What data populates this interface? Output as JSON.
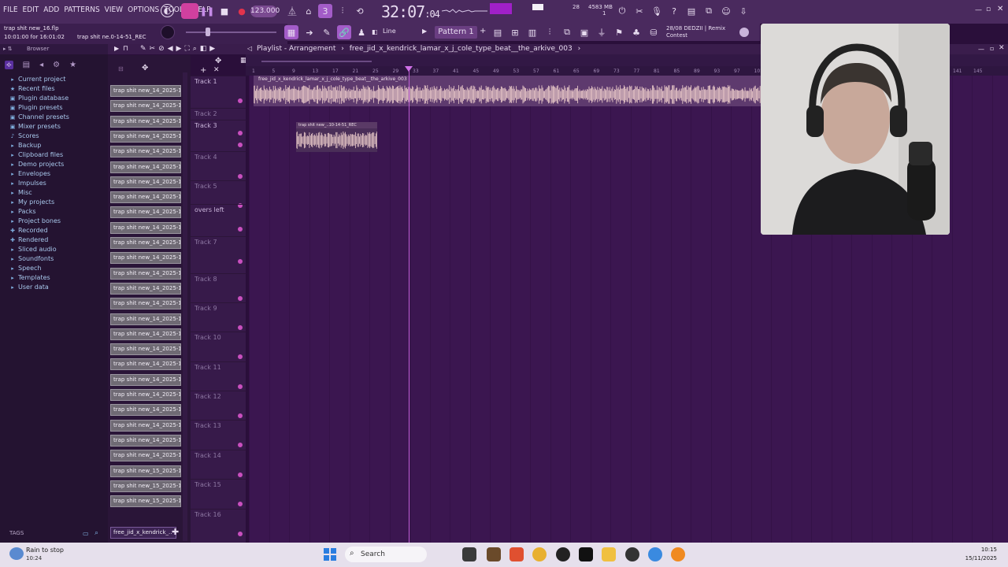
{
  "menu": [
    "FILE",
    "EDIT",
    "ADD",
    "PATTERNS",
    "VIEW",
    "OPTIONS",
    "TOOLS",
    "HELP"
  ],
  "transport": {
    "tempo": "123.000",
    "time": "32:07",
    "time_sub": ":04",
    "cpu": "28",
    "memory": "4583 MB",
    "memory_sub": "1",
    "pattern": "Pattern 1",
    "snap": "Line"
  },
  "hint": {
    "project": "trap shit new_16.flp",
    "duration": "10:01:00 for 16:01:02",
    "recording": "trap shit ne.0-14-51_REC"
  },
  "news": {
    "line1": "28/08  DEDZII | Remix",
    "line2": "Contest"
  },
  "browser": {
    "title": "Browser",
    "items": [
      "Current project",
      "Recent files",
      "Plugin database",
      "Plugin presets",
      "Channel presets",
      "Mixer presets",
      "Scores",
      "Backup",
      "Clipboard files",
      "Demo projects",
      "Envelopes",
      "Impulses",
      "Misc",
      "My projects",
      "Packs",
      "Project bones",
      "Recorded",
      "Rendered",
      "Sliced audio",
      "Soundfonts",
      "Speech",
      "Templates",
      "User data"
    ],
    "tags_label": "TAGS"
  },
  "clips": [
    "trap shit new_14_2025-1..",
    "trap shit new_14_2025-1..",
    "trap shit new_14_2025-1..",
    "trap shit new_14_2025-1..",
    "trap shit new_14_2025-1..",
    "trap shit new_14_2025-1..",
    "trap shit new_14_2025-1..",
    "trap shit new_14_2025-1..",
    "trap shit new_14_2025-1..",
    "trap shit new_14_2025-1..",
    "trap shit new_14_2025-1..",
    "trap shit new_14_2025-1..",
    "trap shit new_14_2025-1..",
    "trap shit new_14_2025-1..",
    "trap shit new_14_2025-1..",
    "trap shit new_14_2025-1..",
    "trap shit new_14_2025-1..",
    "trap shit new_14_2025-1..",
    "trap shit new_14_2025-1..",
    "trap shit new_14_2025-1..",
    "trap shit new_14_2025-1..",
    "trap shit new_14_2025-1..",
    "trap shit new_14_2025-1..",
    "trap shit new_14_2025-1..",
    "trap shit new_14_2025-1..",
    "trap shit new_15_2025-1..",
    "trap shit new_15_2025-1..",
    "trap shit new_15_2025-1.."
  ],
  "clip_selected": "free_jid_x_kendrick_..",
  "playlist": {
    "title": "Playlist - Arrangement",
    "arrangement": "free_jid_x_kendrick_lamar_x_j_cole_type_beat__the_arkive_003",
    "clip_main": "free_jid_x_kendrick_lamar_x_j_cole_type_beat__the_arkive_003",
    "clip_rec": "trap shit new_..10-14-51_REC",
    "ruler": [
      "1",
      "5",
      "9",
      "13",
      "17",
      "21",
      "25",
      "29",
      "33",
      "37",
      "41",
      "45",
      "49",
      "53",
      "57",
      "61",
      "65",
      "69",
      "73",
      "77",
      "81",
      "85",
      "89",
      "93",
      "97",
      "101",
      "141",
      "145"
    ],
    "tracks": [
      {
        "name": "Track 1",
        "dim": false
      },
      {
        "name": "Track 2",
        "dim": true
      },
      {
        "name": "Track 3",
        "dim": false
      },
      {
        "name": "Track 4",
        "dim": true
      },
      {
        "name": "Track 5",
        "dim": true
      },
      {
        "name": "overs left",
        "dim": false
      },
      {
        "name": "Track 7",
        "dim": true
      },
      {
        "name": "Track 8",
        "dim": true
      },
      {
        "name": "Track 9",
        "dim": true
      },
      {
        "name": "Track 10",
        "dim": true
      },
      {
        "name": "Track 11",
        "dim": true
      },
      {
        "name": "Track 12",
        "dim": true
      },
      {
        "name": "Track 13",
        "dim": true
      },
      {
        "name": "Track 14",
        "dim": true
      },
      {
        "name": "Track 15",
        "dim": true
      },
      {
        "name": "Track 16",
        "dim": true
      }
    ]
  },
  "taskbar": {
    "weather_title": "Rain to stop",
    "weather_time": "10:24",
    "search": "Search",
    "clock_time": "10:15",
    "clock_date": "15/11/2025"
  }
}
